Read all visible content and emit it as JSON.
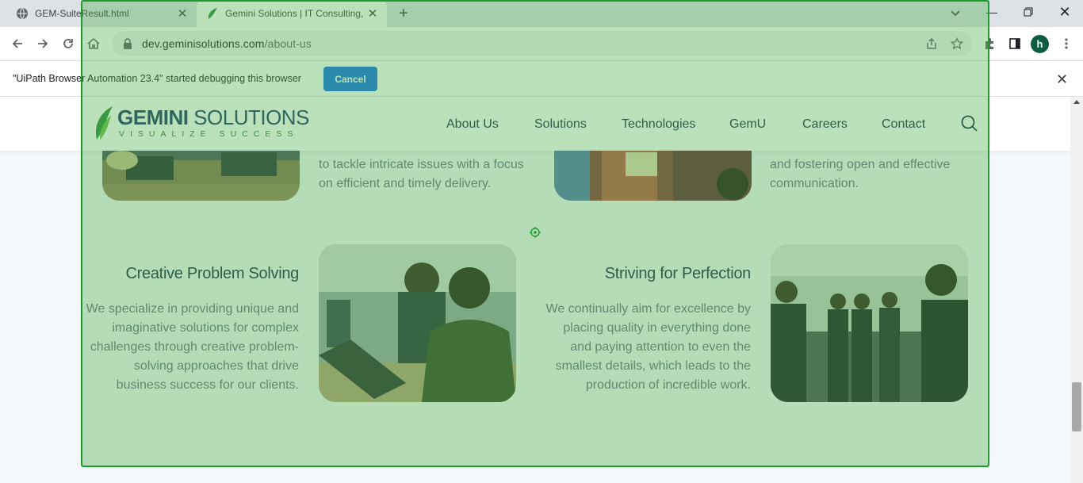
{
  "browser": {
    "tabs": [
      {
        "title": "GEM-SuiteResult.html",
        "icon": "globe-icon"
      },
      {
        "title": "Gemini Solutions | IT Consulting,",
        "icon": "gemini-leaf-icon"
      }
    ],
    "url_host": "dev.geminisolutions.com",
    "url_path": "/about-us",
    "profile_initial": "h"
  },
  "infobar": {
    "message": "\"UiPath Browser Automation 23.4\" started debugging this browser",
    "cancel_label": "Cancel"
  },
  "site": {
    "logo_bold": "GEMINI",
    "logo_rest": " SOLUTIONS",
    "logo_tagline": "VISUALIZE SUCCESS",
    "nav": [
      "About Us",
      "Solutions",
      "Technologies",
      "GemU",
      "Careers",
      "Contact"
    ]
  },
  "content": {
    "top_left_lines": [
      "to tackle intricate issues with a focus",
      "on efficient and timely delivery."
    ],
    "top_right_lines": [
      "and fostering open and effective",
      "communication."
    ],
    "features": [
      {
        "title": "Creative Problem Solving",
        "lines": [
          "We specialize in providing unique and",
          "imaginative solutions for complex",
          "challenges through creative problem-",
          "solving approaches that drive",
          "business success for our clients."
        ]
      },
      {
        "title": "Striving for Perfection",
        "lines": [
          "We continually aim for excellence by",
          "placing quality in everything done",
          "and paying attention to even the",
          "smallest details, which leads to the",
          "production of incredible work."
        ]
      }
    ]
  },
  "colors": {
    "overlay": "#4ab04a",
    "brand_navy": "#1f3b6b",
    "brand_green": "#2e7a3a",
    "cancel_button": "#1a73e8"
  }
}
